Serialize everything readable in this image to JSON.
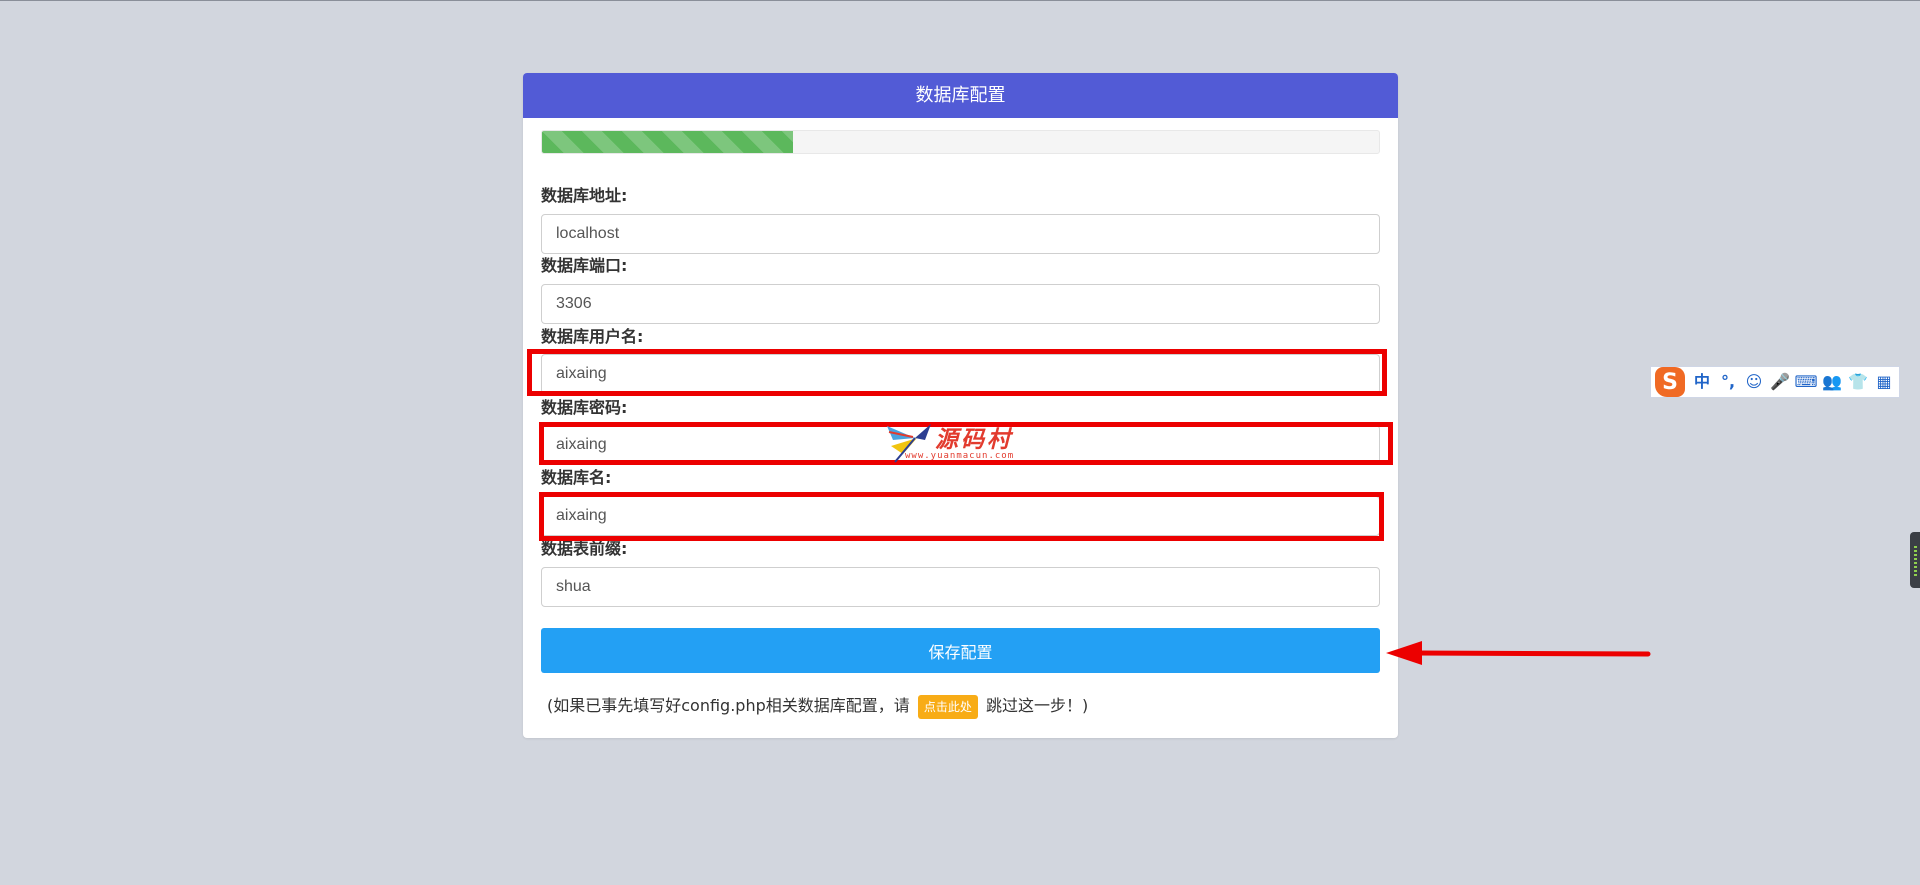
{
  "header": {
    "title": "数据库配置"
  },
  "progress": {
    "percent": 30
  },
  "fields": [
    {
      "label": "数据库地址:",
      "value": "localhost"
    },
    {
      "label": "数据库端口:",
      "value": "3306"
    },
    {
      "label": "数据库用户名:",
      "value": "aixaing"
    },
    {
      "label": "数据库密码:",
      "value": "aixaing"
    },
    {
      "label": "数据库名:",
      "value": "aixaing"
    },
    {
      "label": "数据表前缀:",
      "value": "shua"
    }
  ],
  "save_button": {
    "label": "保存配置"
  },
  "note": {
    "prefix": "(如果已事先填写好config.php相关数据库配置，请",
    "link": "点击此处",
    "suffix": "跳过这一步！)"
  },
  "watermark": {
    "text": "源码村",
    "sub": "www.yuanmacun.com"
  },
  "ime_toolbar": {
    "logo": "S",
    "items": [
      "中",
      "°,",
      "☺",
      "🎤",
      "⌨",
      "👥",
      "👕",
      "▦"
    ]
  },
  "colors": {
    "header": "#525bd6",
    "button": "#23a0f4",
    "progress": "#5cb85c",
    "highlight": "#ec0000",
    "badge": "#f8ac16",
    "background": "#d2d6de"
  }
}
